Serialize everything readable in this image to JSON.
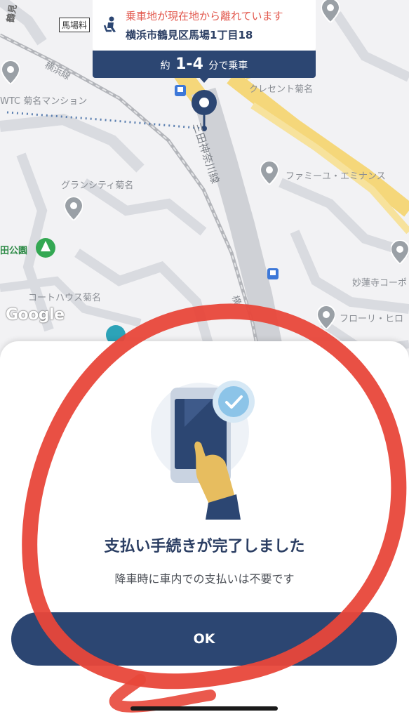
{
  "map": {
    "labels": {
      "line_yokohama": "横浜線",
      "wtc": "WTC 菊名マンション",
      "grandcity": "グランシティ菊名",
      "park": "田公園",
      "courthouse": "コートハウス菊名",
      "crescent": "クレセント菊名",
      "famiyu": "ファミーユ・エミナンス",
      "myorenji": "妙蓮寺コーポ",
      "flory": "フローリ・ヒロ",
      "road_kanagawa": "三田神奈川線",
      "baba": "馬場料",
      "edge_top": "鶴見",
      "edge_side": "横"
    },
    "google_logo": "Google"
  },
  "pickup_bubble": {
    "warning": "乗車地が現在地から離れています",
    "address": "横浜市鶴見区馬場1丁目18",
    "eta_prefix": "約",
    "eta_range": "1-4",
    "eta_suffix": "分で乗車"
  },
  "sheet": {
    "title": "支払い手続きが完了しました",
    "subtitle": "降車時に車内での支払いは不要です",
    "ok_label": "OK"
  },
  "colors": {
    "navy": "#2c4672",
    "warning_red": "#e2574c",
    "annotation_red": "#e8473a",
    "check_blue": "#8cc4e8"
  }
}
